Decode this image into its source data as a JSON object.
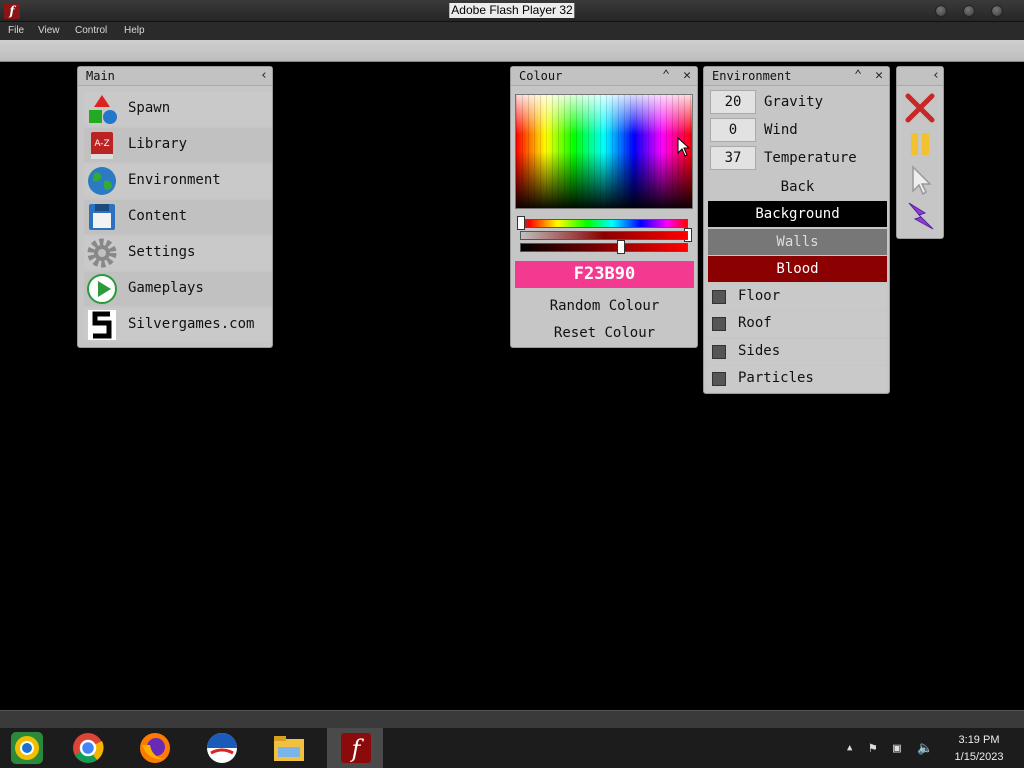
{
  "window": {
    "title": "Adobe Flash Player 32"
  },
  "menu": [
    "File",
    "View",
    "Control",
    "Help"
  ],
  "main_panel": {
    "title": "Main",
    "items": [
      "Spawn",
      "Library",
      "Environment",
      "Content",
      "Settings",
      "Gameplays",
      "Silvergames.com"
    ]
  },
  "colour_panel": {
    "title": "Colour",
    "hex": "F23B90",
    "hex_color": "#f23b90",
    "random_label": "Random Colour",
    "reset_label": "Reset Colour"
  },
  "environment_panel": {
    "title": "Environment",
    "params": [
      {
        "value": "20",
        "label": "Gravity"
      },
      {
        "value": "0",
        "label": "Wind"
      },
      {
        "value": "37",
        "label": "Temperature"
      }
    ],
    "back_label": "Back",
    "background_label": "Background",
    "walls_label": "Walls",
    "blood_label": "Blood",
    "checks": [
      "Floor",
      "Roof",
      "Sides",
      "Particles"
    ]
  },
  "tools": [
    "close-tool-icon",
    "pause-tool-icon",
    "cursor-tool-icon",
    "lightning-tool-icon"
  ],
  "taskbar": {
    "time": "3:19 PM",
    "date": "1/15/2023"
  },
  "colors": {
    "blood": "#8b0000",
    "walls": "#777777",
    "background": "#000000",
    "accent_pink": "#f23b90"
  }
}
